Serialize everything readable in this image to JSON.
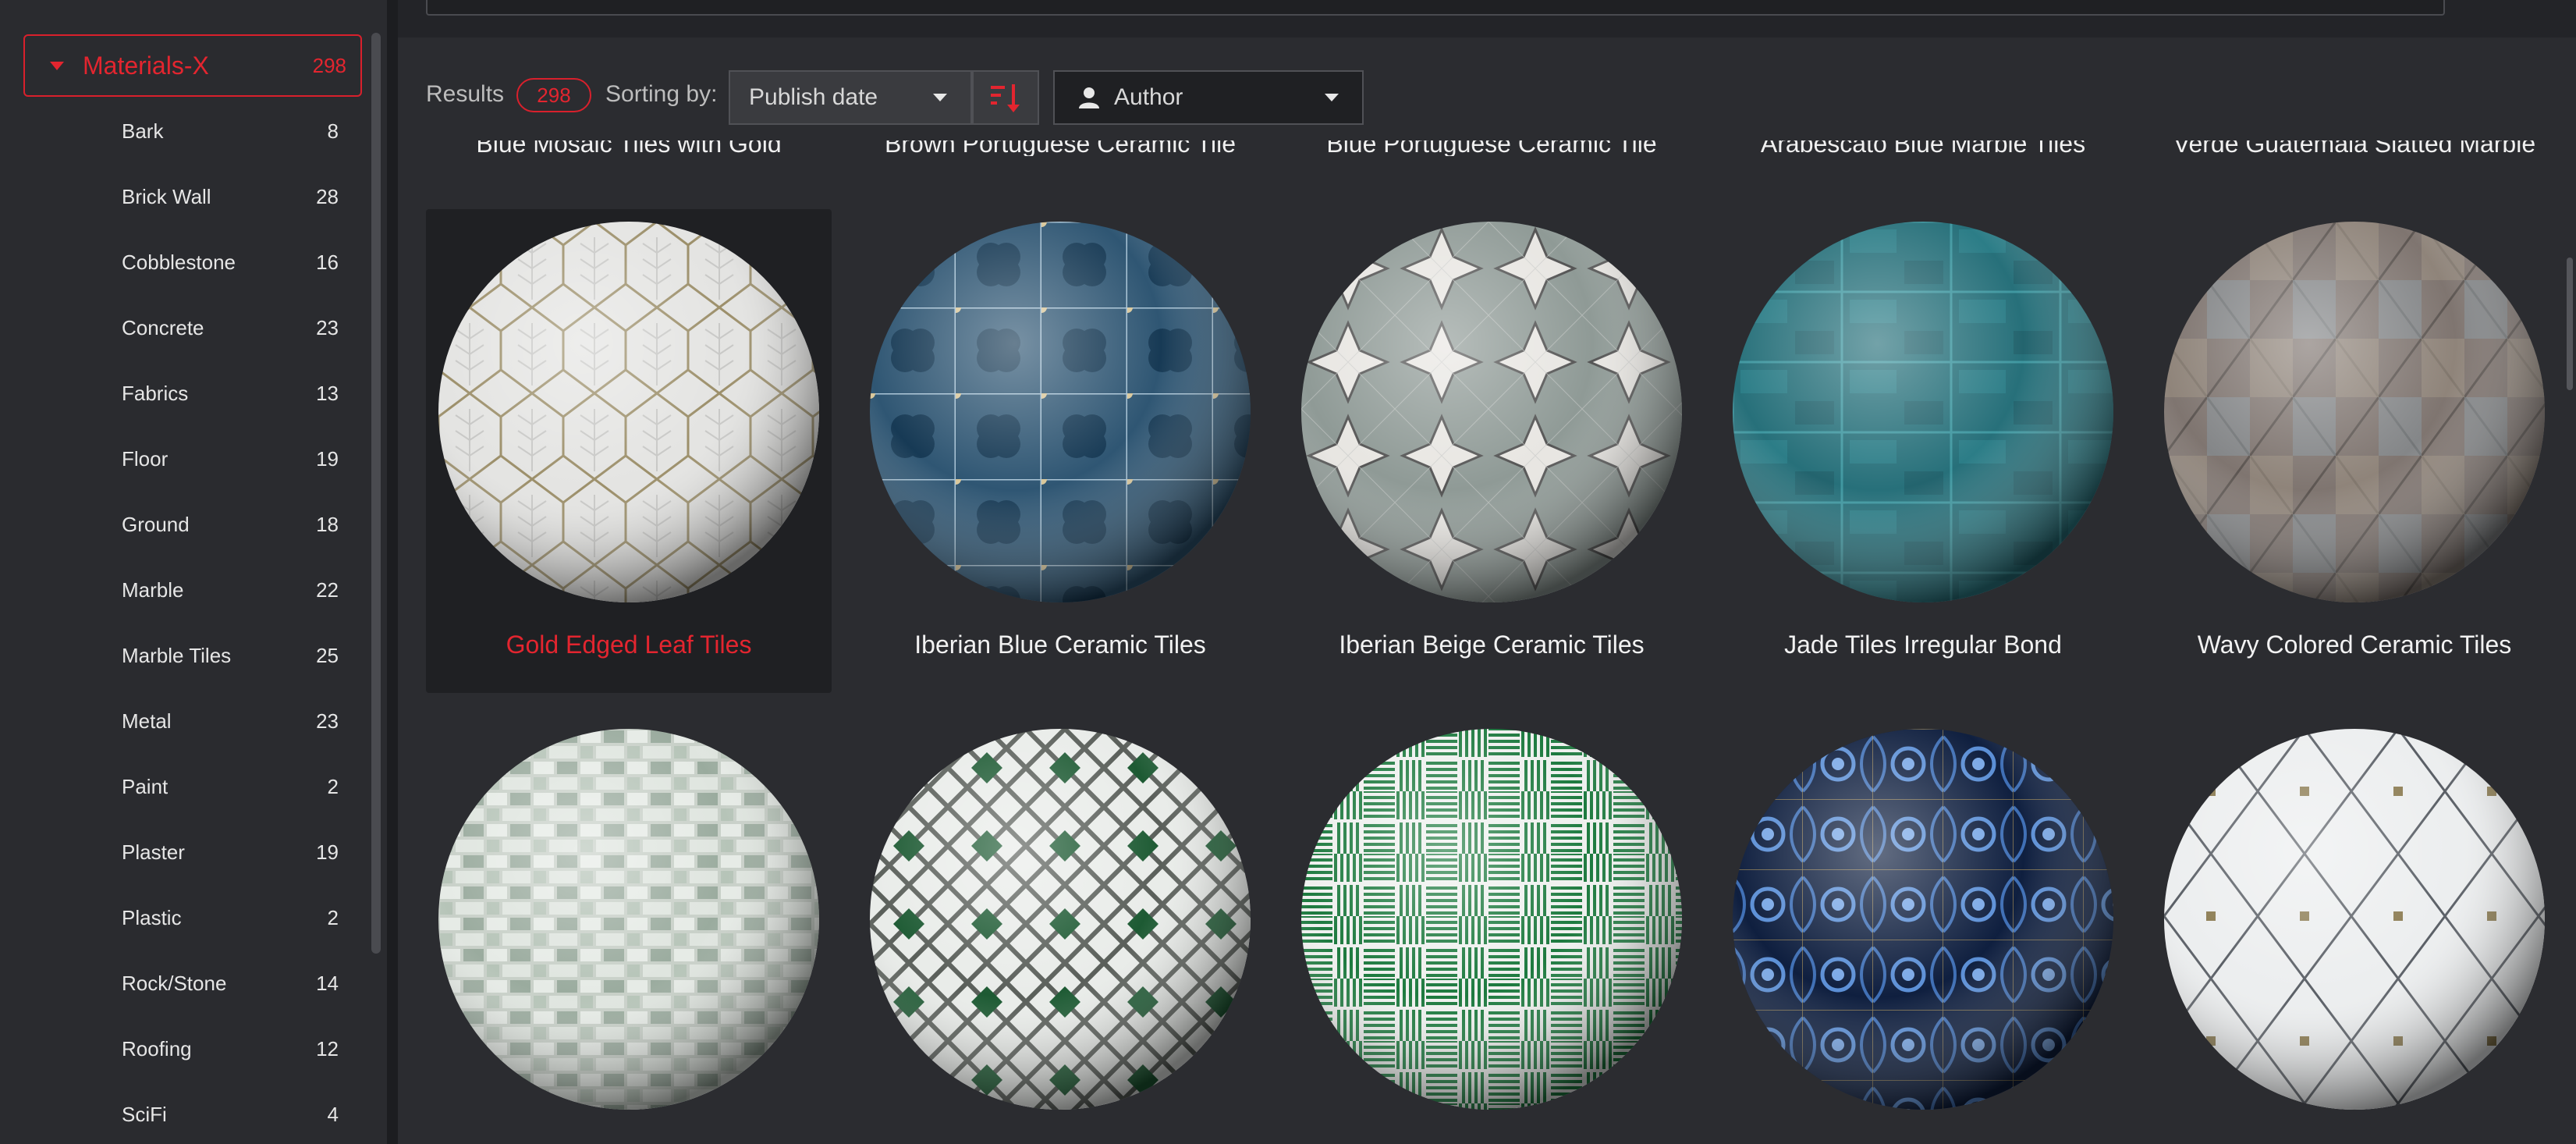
{
  "sidebar": {
    "root": {
      "label": "Materials-X",
      "count": "298"
    },
    "items": [
      {
        "label": "Bark",
        "count": "8"
      },
      {
        "label": "Brick Wall",
        "count": "28"
      },
      {
        "label": "Cobblestone",
        "count": "16"
      },
      {
        "label": "Concrete",
        "count": "23"
      },
      {
        "label": "Fabrics",
        "count": "13"
      },
      {
        "label": "Floor",
        "count": "19"
      },
      {
        "label": "Ground",
        "count": "18"
      },
      {
        "label": "Marble",
        "count": "22"
      },
      {
        "label": "Marble Tiles",
        "count": "25"
      },
      {
        "label": "Metal",
        "count": "23"
      },
      {
        "label": "Paint",
        "count": "2"
      },
      {
        "label": "Plaster",
        "count": "19"
      },
      {
        "label": "Plastic",
        "count": "2"
      },
      {
        "label": "Rock/Stone",
        "count": "14"
      },
      {
        "label": "Roofing",
        "count": "12"
      },
      {
        "label": "SciFi",
        "count": "4"
      }
    ]
  },
  "toolbar": {
    "results_label": "Results",
    "results_count": "298",
    "sorting_label": "Sorting by:",
    "sort_value": "Publish date",
    "author_value": "Author"
  },
  "grid": {
    "row0_titles": [
      "Blue Mosaic Tiles with Gold",
      "Brown Portuguese Ceramic Tile",
      "Blue Portuguese Ceramic Tile",
      "Arabescato Blue Marble Tiles",
      "Verde Guatemala Slatted Marble"
    ],
    "row1": [
      {
        "title": "Gold Edged Leaf Tiles",
        "selected": true,
        "icon": "leaf-tiles-sphere"
      },
      {
        "title": "Iberian Blue Ceramic Tiles",
        "selected": false,
        "icon": "blue-quatrefoil-sphere"
      },
      {
        "title": "Iberian Beige Ceramic Tiles",
        "selected": false,
        "icon": "beige-cross-sphere"
      },
      {
        "title": "Jade Tiles Irregular Bond",
        "selected": false,
        "icon": "jade-tiles-sphere"
      },
      {
        "title": "Wavy Colored Ceramic Tiles",
        "selected": false,
        "icon": "wavy-tiles-sphere"
      }
    ],
    "row2": [
      {
        "icon": "green-mosaic-sphere"
      },
      {
        "icon": "green-diamond-sphere"
      },
      {
        "icon": "green-herringbone-sphere"
      },
      {
        "icon": "blue-floral-sphere"
      },
      {
        "icon": "white-diamond-sphere"
      }
    ]
  },
  "colors": {
    "accent": "#e3252f",
    "background": "#2b2c30",
    "sidebar": "#2a2b2f"
  }
}
